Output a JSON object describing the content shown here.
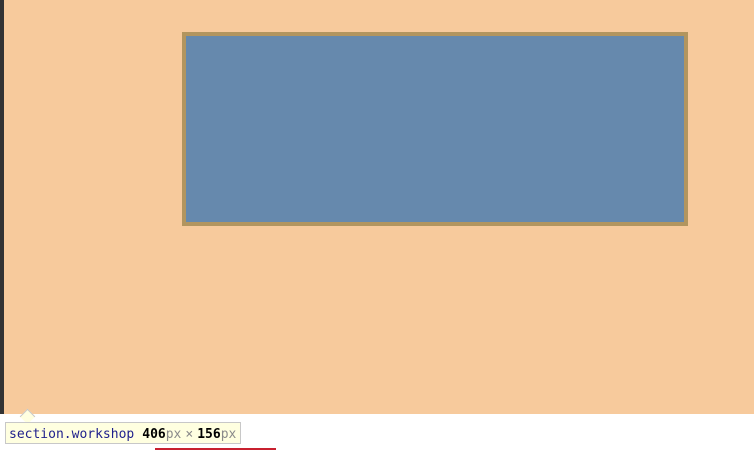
{
  "highlight": {
    "background": "#f7ca9c",
    "box_fill": "#6689ad",
    "box_border": "#b2955f"
  },
  "tooltip": {
    "tag": "section",
    "separator": ".",
    "class_name": "workshop",
    "width_value": "406",
    "width_unit": "px",
    "multiply": "×",
    "height_value": "156",
    "height_unit": "px",
    "background": "#ffffe0"
  },
  "underline_color": "#c8202f"
}
